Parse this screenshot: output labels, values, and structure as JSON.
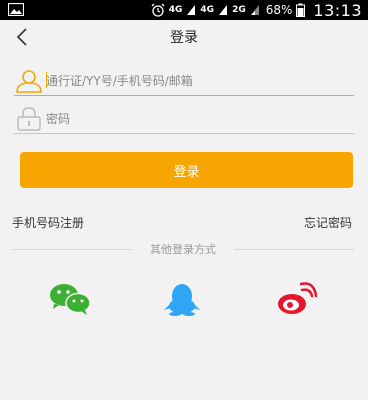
{
  "status_bar": {
    "network_labels": [
      "4G",
      "4G",
      "2G"
    ],
    "battery_percent": "68%",
    "time": "13:13"
  },
  "nav": {
    "title": "登录"
  },
  "form": {
    "account_placeholder": "通行证/YY号/手机号码/邮箱",
    "password_placeholder": "密码"
  },
  "buttons": {
    "login_label": "登录"
  },
  "links": {
    "register": "手机号码注册",
    "forgot_password": "忘记密码"
  },
  "other_login": {
    "divider_text": "其他登录方式",
    "options": [
      "wechat-icon",
      "qq-icon",
      "weibo-icon"
    ]
  },
  "colors": {
    "accent": "#f7a500",
    "background": "#f2f2f2",
    "wechat": "#3cb034",
    "qq": "#2fa6f5",
    "weibo": "#e6162d"
  }
}
